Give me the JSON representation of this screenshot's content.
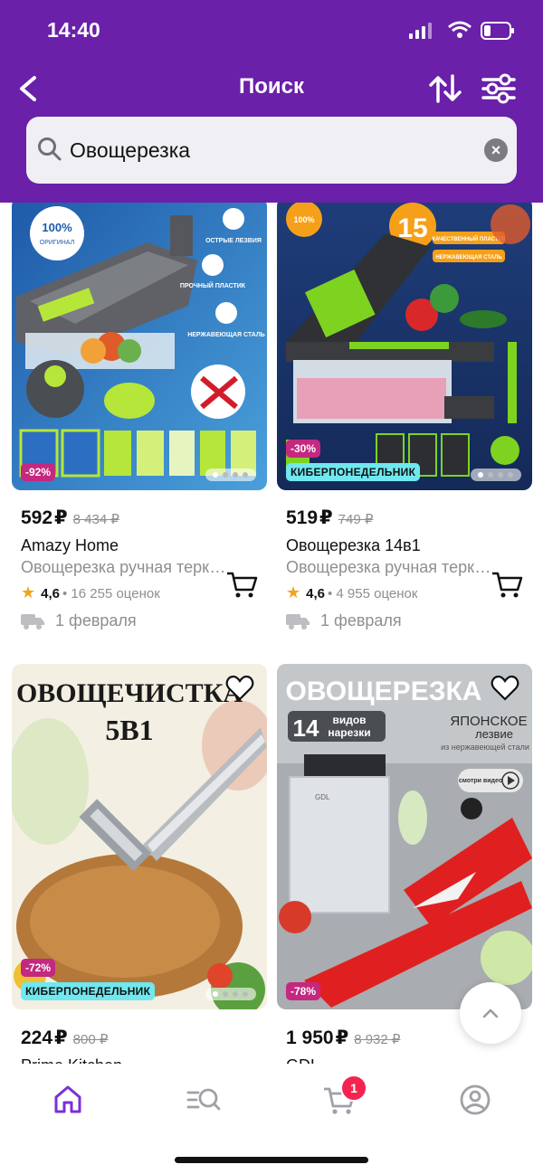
{
  "status_bar": {
    "time": "14:40"
  },
  "header": {
    "title": "Поиск"
  },
  "search": {
    "value": "Овощерезка"
  },
  "products": [
    {
      "discount": "-92%",
      "promo": "",
      "price": "592",
      "currency": "₽",
      "old_price": "8 434 ₽",
      "brand": "Amazy Home",
      "description": "Овощерезка ручная терка с контейнером",
      "rating": "4,6",
      "reviews": "16 255 оценок",
      "delivery": "1 февраля",
      "image_text": [
        "100%",
        "ОРИГИНАЛ",
        "ОСТРЫЕ ЛЕЗВИЯ",
        "ПРОЧНЫЙ ПЛАСТИК",
        "НЕРЖАВЕЮЩАЯ СТАЛЬ"
      ]
    },
    {
      "discount": "-30%",
      "promo": "КИБЕРПОНЕДЕЛЬНИК",
      "price": "519",
      "currency": "₽",
      "old_price": "749 ₽",
      "brand": "Овощерезка 14в1",
      "description": "Овощерезка ручная терка с контейнером",
      "rating": "4,6",
      "reviews": "4 955 оценок",
      "delivery": "1 февраля",
      "image_text": [
        "15",
        "КАЧЕСТВЕННЫЙ ПЛАСТИК",
        "НЕРЖАВЕЮЩАЯ СТАЛЬ",
        "100%"
      ]
    },
    {
      "discount": "-72%",
      "promo": "КИБЕРПОНЕДЕЛЬНИК",
      "price": "224",
      "currency": "₽",
      "old_price": "800 ₽",
      "brand": "Prime Kitchen",
      "image_text": [
        "ОВОЩЕЧИСТКА",
        "5В1"
      ]
    },
    {
      "discount": "-78%",
      "promo": "",
      "price": "1 950",
      "currency": "₽",
      "old_price": "8 932 ₽",
      "brand": "GDL",
      "image_text": [
        "ОВОЩЕРЕЗКА",
        "14",
        "видов",
        "нарезки",
        "ЯПОНСКОЕ",
        "лезвие",
        "из нержавеющей стали",
        "смотри видео",
        "GDL"
      ]
    }
  ],
  "tabbar": {
    "cart_badge": "1"
  },
  "colors": {
    "brand_purple": "#6a20a8",
    "discount_badge": "#c4287f",
    "promo_badge": "#6fe8ef",
    "accent_star": "#f4a21d",
    "cart_badge": "#f5234f"
  },
  "icons": [
    "back-icon",
    "sort-icon",
    "filter-icon",
    "search-icon",
    "clear-icon",
    "heart-icon",
    "cart-icon",
    "truck-icon",
    "star-icon",
    "chevron-up-icon",
    "home-icon",
    "catalog-search-icon",
    "cart-tab-icon",
    "profile-icon"
  ]
}
